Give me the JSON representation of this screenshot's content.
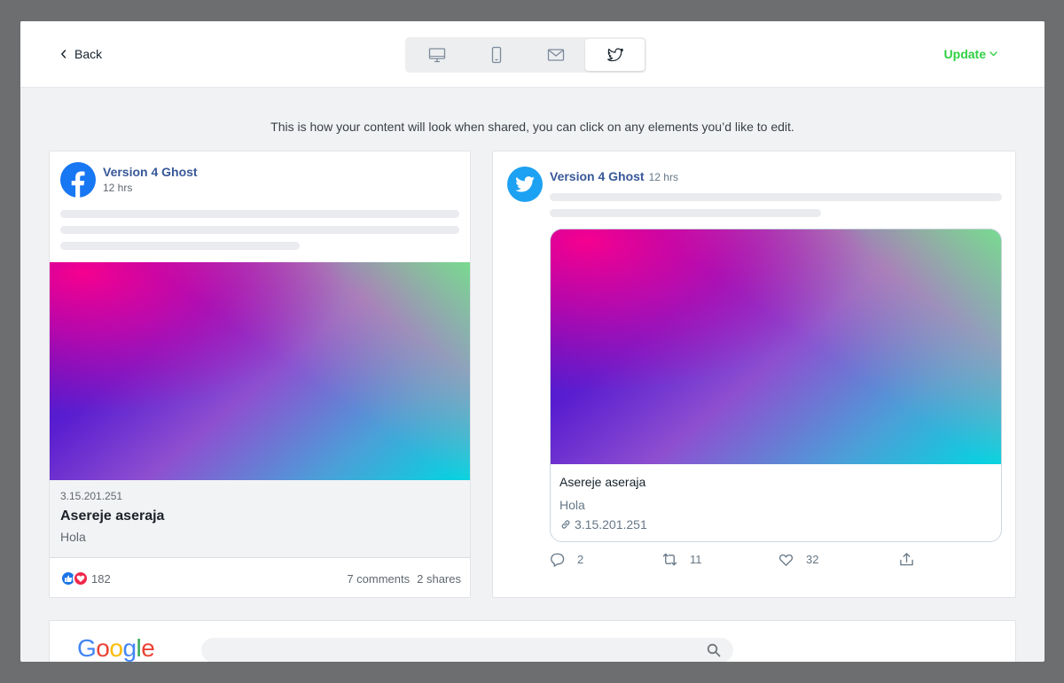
{
  "topbar": {
    "back_label": "Back",
    "update_label": "Update",
    "preview_modes": [
      {
        "name": "desktop",
        "icon": "desktop-icon"
      },
      {
        "name": "mobile",
        "icon": "mobile-icon"
      },
      {
        "name": "email",
        "icon": "mail-icon"
      },
      {
        "name": "twitter",
        "icon": "twitter-icon",
        "active": true
      }
    ]
  },
  "hint": "This is how your content will look when shared, you can click on any elements you’d like to edit.",
  "facebook": {
    "page_name": "Version 4 Ghost",
    "time": "12 hrs",
    "domain": "3.15.201.251",
    "title": "Asereje aseraja",
    "description": "Hola",
    "reaction_count": "182",
    "comments": "7 comments",
    "shares": "2 shares"
  },
  "twitter": {
    "account_name": "Version 4 Ghost",
    "time": "12 hrs",
    "title": "Asereje aseraja",
    "description": "Hola",
    "domain": "3.15.201.251",
    "replies": "2",
    "retweets": "11",
    "likes": "32"
  },
  "google": {
    "logo": "Google"
  },
  "colors": {
    "accent_green": "#30cf43",
    "facebook_blue": "#1877f2",
    "twitter_blue": "#1da1f2",
    "link_blue": "#385898"
  }
}
